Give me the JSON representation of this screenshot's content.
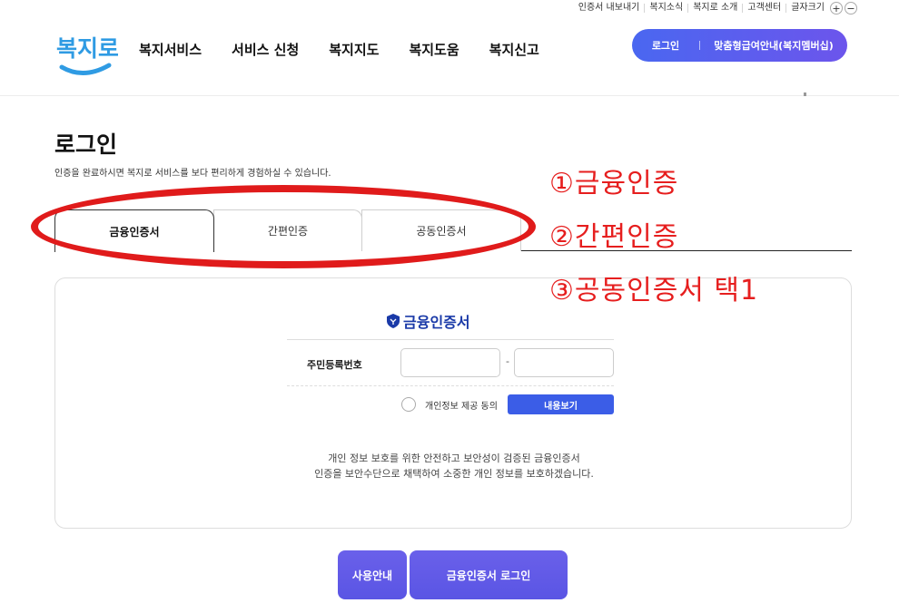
{
  "util": {
    "links": [
      "인증서 내보내기",
      "복지소식",
      "복지로 소개",
      "고객센터",
      "글자크기"
    ],
    "zoom_in": "+",
    "zoom_out": "−"
  },
  "header": {
    "logo_text": "복지로",
    "nav": [
      "복지서비스",
      "서비스 신청",
      "복지지도",
      "복지도움",
      "복지신고"
    ],
    "login": "로그인",
    "welfare_guide": "맞춤형급여안내(복지멤버십)",
    "accent_color": "#4a67f0"
  },
  "page": {
    "title": "로그인",
    "subtitle": "인증을 완료하시면 복지로 서비스를 보다 편리하게 경험하실 수 있습니다."
  },
  "tabs": [
    "금융인증서",
    "간편인증",
    "공동인증서"
  ],
  "annotation": {
    "lines": [
      "①금융인증",
      "②간편인증",
      "③공동인증서 택1"
    ],
    "color": "#e01b1b"
  },
  "card": {
    "title": "금융인증서",
    "icon": "shield-icon",
    "rrn_label": "주민등록번호",
    "dash": "-",
    "consent_label": "개인정보 제공 동의",
    "view_button": "내용보기",
    "desc_line1": "개인 정보 보호를 위한 안전하고 보안성이 검증된 금융인증서",
    "desc_line2": "인증을 보안수단으로 채택하여 소중한 개인 정보를 보호하겠습니다."
  },
  "buttons": {
    "guide": "사용안내",
    "login": "금융인증서 로그인"
  }
}
